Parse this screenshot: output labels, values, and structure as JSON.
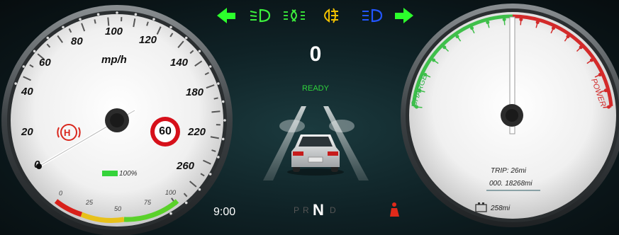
{
  "indicators": [
    {
      "name": "left-turn-signal-icon",
      "color": "#2cff2c"
    },
    {
      "name": "low-beam-icon",
      "color": "#3cf03c"
    },
    {
      "name": "front-fog-light-icon",
      "color": "#3cf03c"
    },
    {
      "name": "rear-fog-light-icon",
      "color": "#f0c000"
    },
    {
      "name": "high-beam-icon",
      "color": "#2255ff"
    },
    {
      "name": "right-turn-signal-icon",
      "color": "#2cff2c"
    }
  ],
  "speedometer": {
    "unit": "mp/h",
    "ticks": [
      "0",
      "20",
      "40",
      "60",
      "80",
      "100",
      "120",
      "140",
      "180",
      "220",
      "260"
    ],
    "current_speed": "0",
    "speed_limit": "60",
    "battery_percent": "100%",
    "battery_level": 1.0,
    "battery_scale": [
      "0",
      "25",
      "50",
      "75",
      "100"
    ],
    "hold_label": "H"
  },
  "center": {
    "speed": "0",
    "status": "READY",
    "time": "9:00",
    "gears": [
      "P",
      "R",
      "N",
      "D"
    ],
    "active_gear": "N",
    "seatbelt_warning_color": "#e02a1a"
  },
  "power_gauge": {
    "charge_label": "CHARGE",
    "power_label": "POWER",
    "trip": "TRIP: 26mi",
    "odometer": "000. 18268mi",
    "range": "258mi"
  }
}
